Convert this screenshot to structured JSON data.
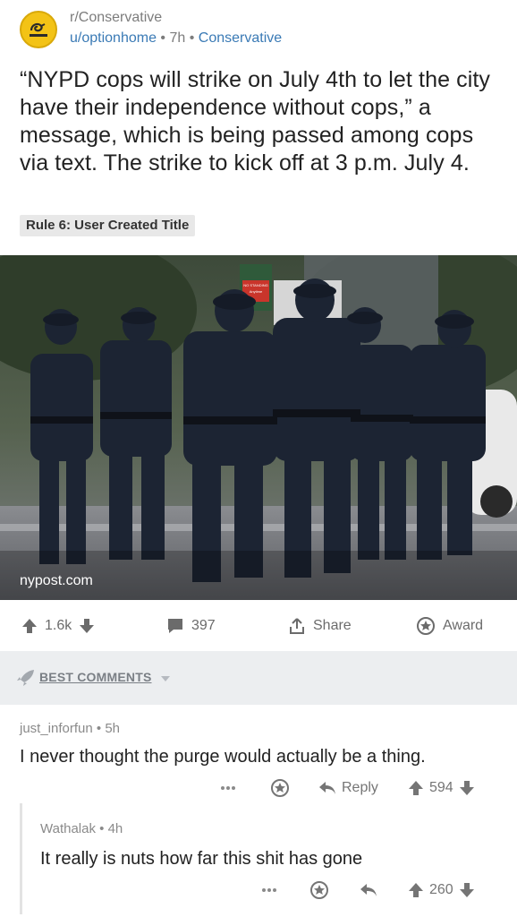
{
  "post": {
    "subreddit": "r/Conservative",
    "user": "u/optionhome",
    "time": "7h",
    "flair": "Conservative",
    "title": "“NYPD cops will strike on July 4th to let the city have their independence without cops,” a message, which is being passed among cops via text. The strike to kick off at 3 p.m. July 4.",
    "rule_tag": "Rule 6: User Created Title",
    "image_source": "nypost.com",
    "sign_text_1": "NO STANDING",
    "sign_text_2": "Anytime"
  },
  "actions": {
    "votes": "1.6k",
    "comments": "397",
    "share": "Share",
    "award": "Award"
  },
  "comments_header": {
    "label": "BEST COMMENTS"
  },
  "comments": [
    {
      "author": "just_inforfun",
      "time": "5h",
      "body": "I never thought the purge would actually be a thing.",
      "reply_label": "Reply",
      "score": "594"
    },
    {
      "author": "Wathalak",
      "time": "4h",
      "body": "It really is nuts how far this shit has gone",
      "score": "260"
    }
  ],
  "colors": {
    "link_blue": "#3a7ab5",
    "meta_gray": "#7c7c7c",
    "bar_gray": "#eceef0",
    "badge_yellow": "#f3c316",
    "uniform_navy": "#1c2433"
  },
  "icons": [
    "gadsden-flag-icon",
    "upvote-icon",
    "downvote-icon",
    "comment-icon",
    "share-icon",
    "award-icon",
    "rocket-icon",
    "chevron-down-icon",
    "more-icon",
    "reply-icon"
  ]
}
